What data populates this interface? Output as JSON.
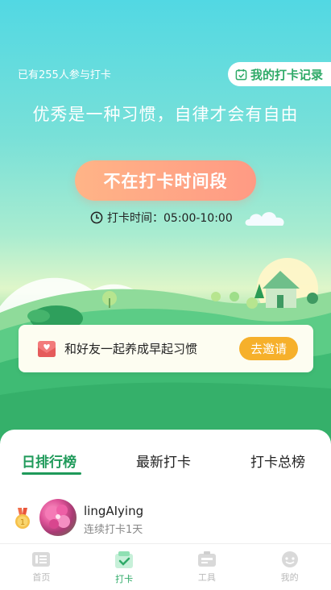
{
  "header": {
    "participants_text": "已有255人参与打卡",
    "record_button": "我的打卡记录",
    "motto": "优秀是一种习惯，自律才会有自由"
  },
  "checkin": {
    "button_label": "不在打卡时间段",
    "time_label": "打卡时间：05:00-10:00"
  },
  "invite": {
    "text": "和好友一起养成早起习惯",
    "button_label": "去邀请"
  },
  "ranking": {
    "tabs": [
      {
        "label": "日排行榜",
        "active": true
      },
      {
        "label": "最新打卡",
        "active": false
      },
      {
        "label": "打卡总榜",
        "active": false
      }
    ],
    "entries": [
      {
        "rank": "1",
        "name": "lingAIying",
        "streak": "连续打卡1天"
      }
    ]
  },
  "nav": {
    "items": [
      {
        "label": "首页",
        "icon": "home-icon",
        "active": false
      },
      {
        "label": "打卡",
        "icon": "checkin-icon",
        "active": true
      },
      {
        "label": "工具",
        "icon": "tools-icon",
        "active": false
      },
      {
        "label": "我的",
        "icon": "profile-icon",
        "active": false
      }
    ]
  },
  "colors": {
    "brand_green": "#2faa68",
    "button_orange": "#ffa585",
    "invite_orange": "#f6b02b"
  }
}
